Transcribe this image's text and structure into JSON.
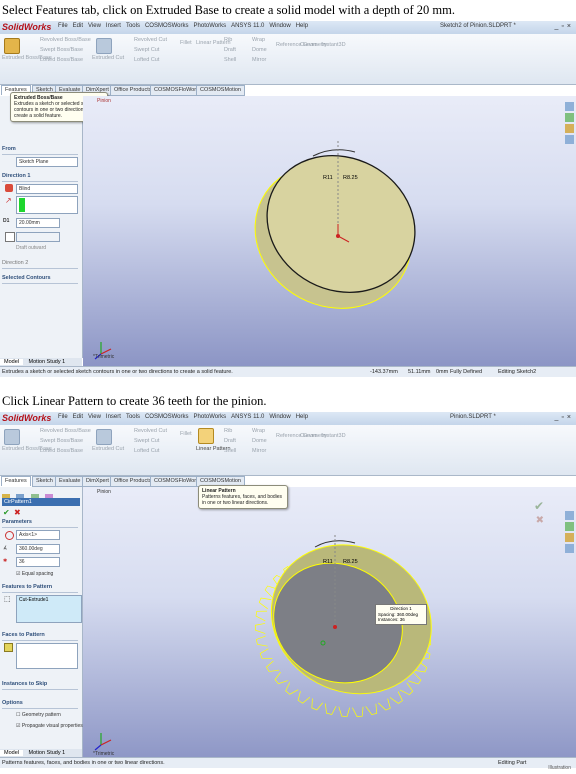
{
  "captions": {
    "step1": "Select Features tab, click on Extruded Base to create a solid model with a depth of 20 mm.",
    "step2": "Click Linear Pattern to create 36 teeth for the pinion."
  },
  "app": {
    "logo": "SolidWorks",
    "menu": [
      "File",
      "Edit",
      "View",
      "Insert",
      "Tools",
      "COSMOSWorks",
      "PhotoWorks",
      "ANSYS 11.0",
      "Window",
      "Help"
    ]
  },
  "shot1": {
    "window_title": "Sketch2 of Pinion.SLDPRT *",
    "tabs": [
      "Features",
      "Sketch",
      "Evaluate",
      "DimXpert",
      "Office Products",
      "COSMOSFloWorks",
      "COSMOSMotion"
    ],
    "ribbon_buttons": [
      "Extruded Boss/Base",
      "Revolved Boss/Base",
      "Swept Boss/Base",
      "Lofted Boss/Base",
      "Extruded Cut",
      "Revolved Cut",
      "Swept Cut",
      "Lofted Cut",
      "Fillet",
      "Linear Pattern",
      "Rib",
      "Draft",
      "Shell",
      "Wrap",
      "Dome",
      "Mirror",
      "Reference Geometry",
      "Curves",
      "Instant3D"
    ],
    "tooltip": {
      "title": "Extruded Boss/Base",
      "body": "Extrudes a sketch or selected sketch contours in one or two directions to create a solid feature."
    },
    "tree_label": "Pinion",
    "panel": {
      "from_label": "From",
      "from_value": "Sketch Plane",
      "direction_label": "Direction 1",
      "end_condition": "Blind",
      "depth": "20.00mm",
      "draft_outward": "Draft outward",
      "direction2_label": "Direction 2",
      "selected_contours": "Selected Contours"
    },
    "dimensions": [
      "R11",
      "R8.25"
    ],
    "viewport_label": "*Trimetric",
    "bottom_tabs": [
      "Model",
      "Motion Study 1"
    ],
    "status": {
      "message": "Extrudes a sketch or selected sketch contours in one or two directions to create a solid feature.",
      "x": "-143.37mm",
      "y": "51.11mm",
      "z": "0mm",
      "state": "Fully Defined",
      "editing": "Editing Sketch2"
    }
  },
  "shot2": {
    "window_title": "Pinion.SLDPRT *",
    "tabs": [
      "Features",
      "Sketch",
      "Evaluate",
      "DimXpert",
      "Office Products",
      "COSMOSFloWorks",
      "COSMOSMotion"
    ],
    "tooltip": {
      "title": "Linear Pattern",
      "body": "Patterns features, faces, and bodies in one or two linear directions."
    },
    "tree_label": "Pinion",
    "panel": {
      "title": "CirPattern1",
      "parameters": "Parameters",
      "axis": "Axis<1>",
      "angle": "360.00deg",
      "instances": "36",
      "equal_spacing": "Equal spacing",
      "features_to_pattern": "Features to Pattern",
      "feature_item": "Cut-Extrude1",
      "faces_to_pattern": "Faces to Pattern",
      "instances_to_skip": "Instances to Skip",
      "options": "Options",
      "geometry_pattern": "Geometry pattern",
      "propagate": "Propagate visual properties"
    },
    "callout": {
      "title": "Direction 1",
      "spacing_label": "Spacing:",
      "spacing_value": "360.00deg",
      "instances_label": "Instances:",
      "instances_value": "36"
    },
    "dimensions": [
      "R11",
      "R8.25"
    ],
    "viewport_label": "*Trimetric",
    "bottom_tabs": [
      "Model",
      "Motion Study 1"
    ],
    "status": {
      "message": "Patterns features, faces, and bodies in one or two linear directions.",
      "editing": "Editing Part"
    }
  },
  "footer_mark": "Illustration"
}
